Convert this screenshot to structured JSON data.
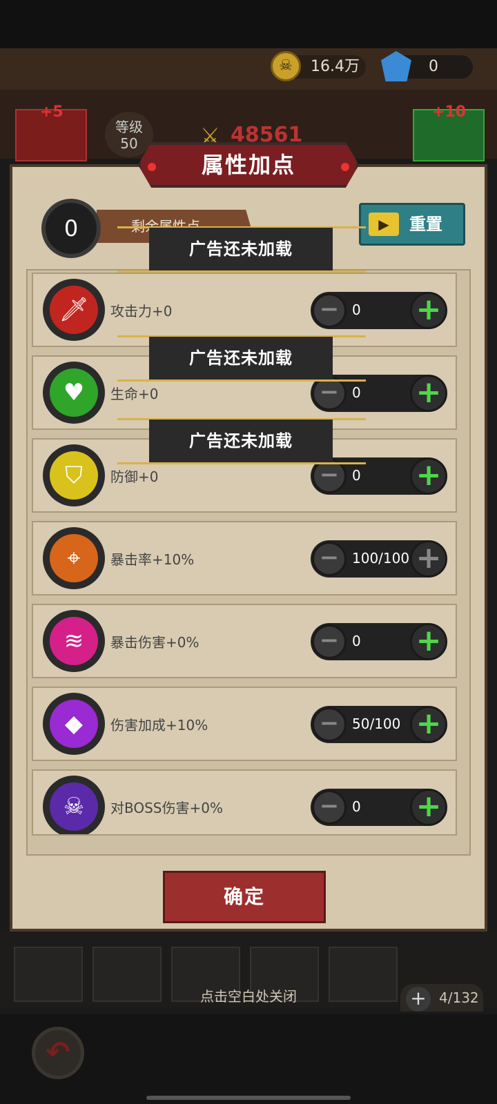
{
  "topbar": {
    "coins": "16.4万",
    "gems": "0"
  },
  "behind": {
    "left_plus": "+5",
    "right_plus": "+10",
    "level_label": "等级",
    "level_value": "50",
    "power": "48561"
  },
  "panel": {
    "title": "属性加点",
    "points_value": "0",
    "points_label": "剩余属性点",
    "reset_label": "重置",
    "rows": [
      {
        "label": "攻击力+0",
        "value": "0",
        "icon": "sword-icon",
        "color": "#c0261f"
      },
      {
        "label": "生命+0",
        "value": "0",
        "icon": "heart-icon",
        "color": "#2fa52a"
      },
      {
        "label": "防御+0",
        "value": "0",
        "icon": "shield-icon",
        "color": "#d9c21c"
      },
      {
        "label": "暴击率+10%",
        "value": "100/100",
        "icon": "crosshair-icon",
        "color": "#d7651a"
      },
      {
        "label": "暴击伤害+0%",
        "value": "0",
        "icon": "claw-icon",
        "color": "#d5208a"
      },
      {
        "label": "伤害加成+10%",
        "value": "50/100",
        "icon": "crystal-icon",
        "color": "#9a2ad1"
      },
      {
        "label": "对BOSS伤害+0%",
        "value": "0",
        "icon": "demon-skull-icon",
        "color": "#5a2aa8"
      }
    ],
    "ad_toasts": [
      "广告还未加载",
      "广告还未加载",
      "广告还未加载"
    ],
    "confirm_label": "确定"
  },
  "bottom": {
    "close_hint": "点击空白处关闭",
    "inventory": "4/132"
  }
}
